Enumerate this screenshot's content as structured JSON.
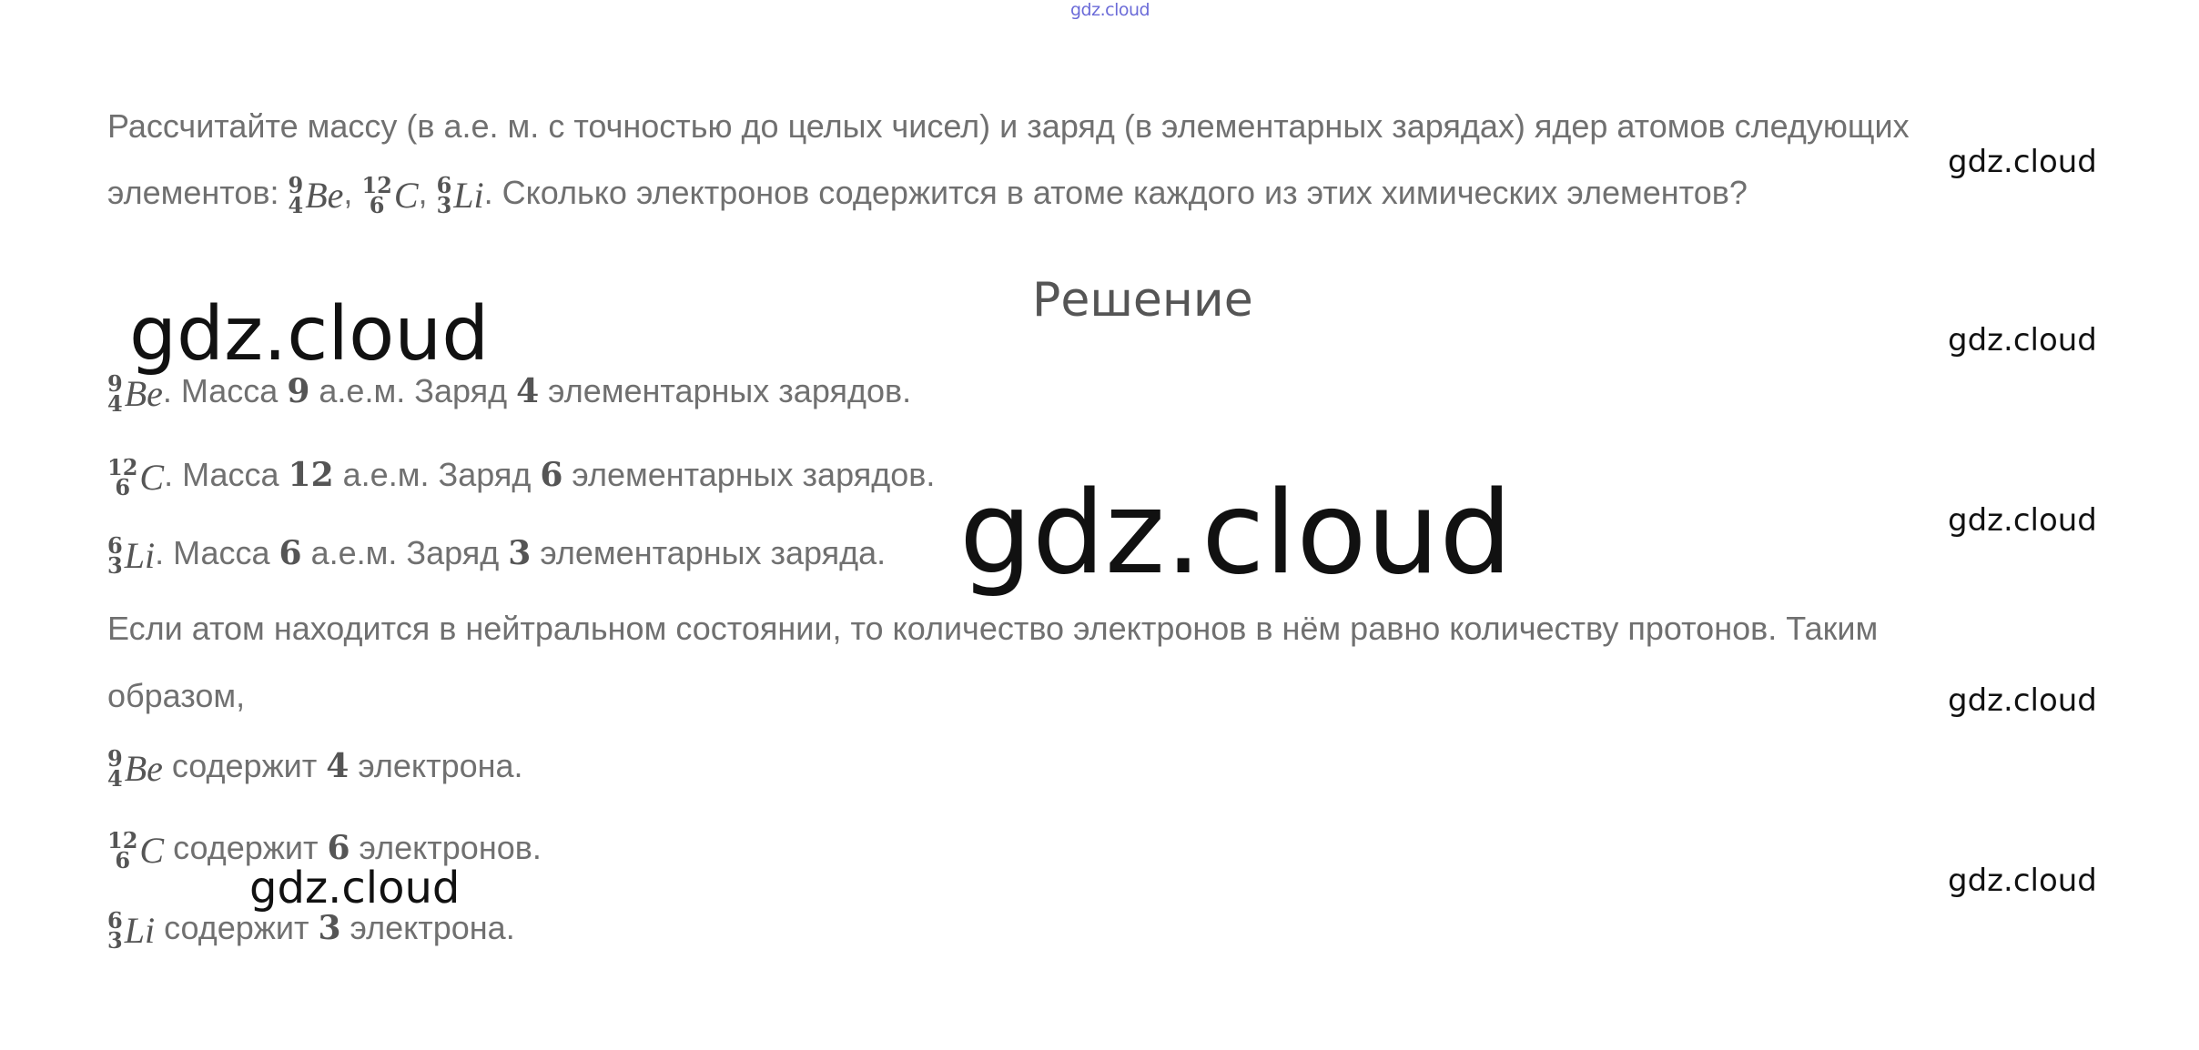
{
  "header": {
    "watermark": "gdz.cloud"
  },
  "task": {
    "line1": "Рассчитайте массу (в а.е. м. с точностью до целых чисел) и заряд (в элементарных зарядах) ядер атомов следующих",
    "line2_prefix": "элементов:",
    "isotopes": [
      {
        "mass": "9",
        "number": "4",
        "symbol": "Be"
      },
      {
        "mass": "12",
        "number": "6",
        "symbol": "C"
      },
      {
        "mass": "6",
        "number": "3",
        "symbol": "Li"
      }
    ],
    "separator": ",",
    "line2_suffix": ". Сколько электронов содержится в атоме каждого из этих химических элементов?"
  },
  "solution": {
    "title": "Решение",
    "rows": [
      {
        "mass": "9",
        "number": "4",
        "symbol": "Be",
        "t1": ". Масса ",
        "v1": "9",
        "t2": " а.е.м. Заряд ",
        "v2": "4",
        "t3": " элементарных зарядов."
      },
      {
        "mass": "12",
        "number": "6",
        "symbol": "C",
        "t1": ". Масса ",
        "v1": "12",
        "t2": " а.е.м. Заряд ",
        "v2": "6",
        "t3": " элементарных зарядов."
      },
      {
        "mass": "6",
        "number": "3",
        "symbol": "Li",
        "t1": ". Масса ",
        "v1": "6",
        "t2": " а.е.м. Заряд ",
        "v2": "3",
        "t3": " элементарных заряда."
      }
    ],
    "explanation_line1": "Если атом находится в нейтральном состоянии, то количество электронов в нём равно количеству протонов. Таким",
    "explanation_line2": "образом,",
    "electrons": [
      {
        "mass": "9",
        "number": "4",
        "symbol": "Be",
        "text": " содержит ",
        "value": "4",
        "unit": " электрона."
      },
      {
        "mass": "12",
        "number": "6",
        "symbol": "C",
        "text": " содержит ",
        "value": "6",
        "unit": " электронов."
      },
      {
        "mass": "6",
        "number": "3",
        "symbol": "Li",
        "text": " содержит ",
        "value": "3",
        "unit": " электрона."
      }
    ]
  },
  "watermarks": {
    "side": [
      "gdz.cloud",
      "gdz.cloud",
      "gdz.cloud",
      "gdz.cloud",
      "gdz.cloud"
    ],
    "big_left": "gdz.cloud",
    "center": "gdz.cloud",
    "lower": "gdz.cloud"
  }
}
